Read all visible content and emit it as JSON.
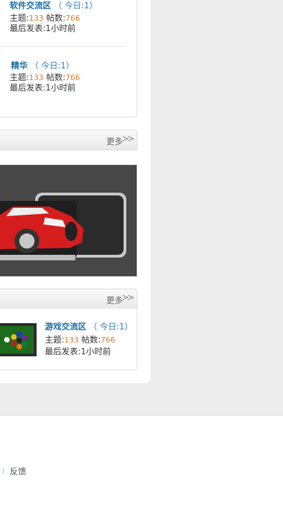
{
  "forums": [
    {
      "title": "软件交流区",
      "today": "（ 今日:1）",
      "topic_label": "主题:",
      "topic": "133",
      "post_label": "帖数:",
      "posts": "766",
      "last_post": "最后发表:1小时前"
    },
    {
      "title": "精华",
      "today": "（ 今日:1）",
      "topic_label": "主题:",
      "topic": "133",
      "post_label": "帖数:",
      "posts": "766",
      "last_post": "最后发表:1小时前"
    }
  ],
  "panel_more": "更多",
  "more_icon": "double-chevron-right-icon",
  "game_forum": {
    "title": "游戏交流区",
    "today": "（ 今日:1）",
    "topic_label": "主题:",
    "topic": "133",
    "post_label": "帖数:",
    "posts": "766",
    "last_post": "最后发表:1小时前"
  },
  "footer": {
    "feedback": "反馈"
  },
  "colors": {
    "link": "#1a6fa5",
    "count": "#e07b20",
    "banner_bg": "#454545"
  }
}
